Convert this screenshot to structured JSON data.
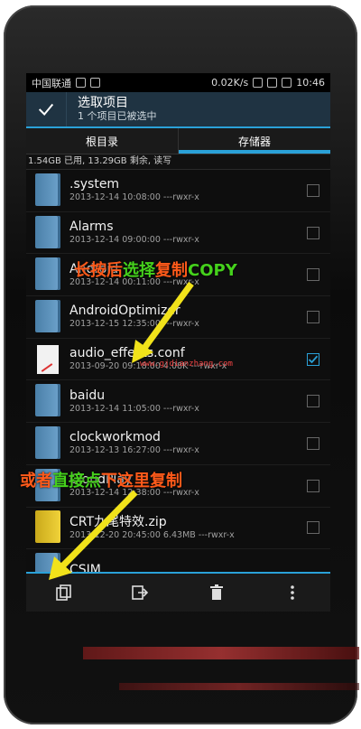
{
  "status_bar": {
    "carrier": "中国联通",
    "speed": "0.02K/s",
    "time": "10:46"
  },
  "action_bar": {
    "title": "选取项目",
    "subtitle": "1 个项目已被选中"
  },
  "tabs": [
    {
      "label": "根目录",
      "active": false
    },
    {
      "label": "存储器",
      "active": true
    }
  ],
  "storage_info": "1.54GB 已用, 13.29GB 剩余, 读写",
  "files": [
    {
      "name": ".system",
      "meta": "2013-12-14 10:08:00   ---rwxr-x",
      "type": "folder",
      "checked": false
    },
    {
      "name": "Alarms",
      "meta": "2013-12-14 09:00:00   ---rwxr-x",
      "type": "folder",
      "checked": false
    },
    {
      "name": "Android",
      "meta": "2013-12-14 00:11:00   ---rwxr-x",
      "type": "folder",
      "checked": false
    },
    {
      "name": "AndroidOptimizer",
      "meta": "2013-12-15 12:35:00   ---rwxr-x",
      "type": "folder",
      "checked": false
    },
    {
      "name": "audio_effects.conf",
      "meta": "2013-09-20 09:18:00  4.08K  ---rwxr-x",
      "type": "file",
      "checked": true
    },
    {
      "name": "baidu",
      "meta": "2013-12-14 11:05:00   ---rwxr-x",
      "type": "folder",
      "checked": false
    },
    {
      "name": "clockworkmod",
      "meta": "2013-12-13 16:27:00   ---rwxr-x",
      "type": "folder",
      "checked": false
    },
    {
      "name": "CloudPlay",
      "meta": "2013-12-14 12:38:00   ---rwxr-x",
      "type": "folder",
      "checked": false
    },
    {
      "name": "CRT九尾特效.zip",
      "meta": "2013-12-20 20:45:00  6.43MB  ---rwxr-x",
      "type": "zip",
      "checked": false
    },
    {
      "name": "CSIM",
      "meta": "",
      "type": "folder",
      "checked": false
    }
  ],
  "annotations": {
    "long_press": [
      {
        "text": "长按后",
        "color": "#ff5a1a"
      },
      {
        "text": "选择",
        "color": "#45d11c"
      },
      {
        "text": "复制",
        "color": "#ff5a1a"
      },
      {
        "text": "COPY",
        "color": "#45d11c"
      }
    ],
    "or_tap": [
      {
        "text": "或者",
        "color": "#ff5a1a"
      },
      {
        "text": "直接点",
        "color": "#45d11c"
      },
      {
        "text": "下这里",
        "color": "#ff5a1a"
      },
      {
        "text": "复制",
        "color": "#ff5a1a"
      }
    ],
    "watermark": "www.gjdianzhang.com",
    "arrow_color": "#f1e21a"
  },
  "colors": {
    "accent": "#2aa1d8",
    "action_bar_bg": "#1f3342"
  },
  "icons": {
    "done": "check-icon",
    "copy": "copy-icon",
    "move": "move-icon",
    "delete": "trash-icon",
    "more": "overflow-menu-icon"
  }
}
